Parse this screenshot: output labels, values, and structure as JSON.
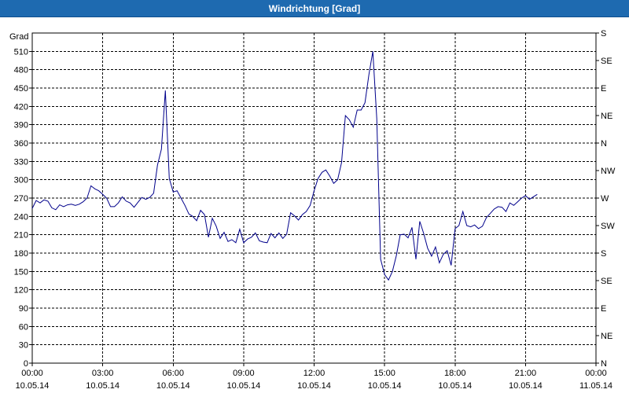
{
  "window": {
    "title": "Windrichtung [Grad]"
  },
  "colors": {
    "titlebar": "#1e6ab0",
    "line": "#00008b",
    "grid": "#000000"
  },
  "chart_data": {
    "type": "line",
    "title": "Windrichtung [Grad]",
    "ylabel": "Grad",
    "ylim": [
      0,
      540
    ],
    "yticks": [
      0,
      30,
      60,
      90,
      120,
      150,
      180,
      210,
      240,
      270,
      300,
      330,
      360,
      390,
      420,
      450,
      480,
      510
    ],
    "y2_labels": [
      "N",
      "NE",
      "E",
      "SE",
      "S",
      "SW",
      "W",
      "NW",
      "N",
      "NE",
      "E",
      "SE",
      "S"
    ],
    "xlim": [
      "10.05.14 00:00",
      "11.05.14 00:00"
    ],
    "x_ticks": [
      {
        "time": "00:00",
        "date": "10.05.14"
      },
      {
        "time": "03:00",
        "date": "10.05.14"
      },
      {
        "time": "06:00",
        "date": "10.05.14"
      },
      {
        "time": "09:00",
        "date": "10.05.14"
      },
      {
        "time": "12:00",
        "date": "10.05.14"
      },
      {
        "time": "15:00",
        "date": "10.05.14"
      },
      {
        "time": "18:00",
        "date": "10.05.14"
      },
      {
        "time": "21:00",
        "date": "10.05.14"
      },
      {
        "time": "00:00",
        "date": "11.05.14"
      }
    ],
    "grid": true,
    "series": [
      {
        "color": "#00008b",
        "points": [
          [
            "00:00",
            253
          ],
          [
            "00:10",
            266
          ],
          [
            "00:20",
            262
          ],
          [
            "00:30",
            267
          ],
          [
            "00:40",
            265
          ],
          [
            "00:50",
            254
          ],
          [
            "01:00",
            251
          ],
          [
            "01:10",
            259
          ],
          [
            "01:20",
            256
          ],
          [
            "01:30",
            259
          ],
          [
            "01:40",
            260
          ],
          [
            "01:50",
            258
          ],
          [
            "02:00",
            260
          ],
          [
            "02:10",
            264
          ],
          [
            "02:20",
            270
          ],
          [
            "02:30",
            290
          ],
          [
            "02:40",
            285
          ],
          [
            "02:50",
            282
          ],
          [
            "03:00",
            276
          ],
          [
            "03:10",
            270
          ],
          [
            "03:20",
            256
          ],
          [
            "03:30",
            256
          ],
          [
            "03:40",
            262
          ],
          [
            "03:50",
            272
          ],
          [
            "04:00",
            265
          ],
          [
            "04:10",
            262
          ],
          [
            "04:20",
            255
          ],
          [
            "04:30",
            263
          ],
          [
            "04:40",
            271
          ],
          [
            "04:50",
            268
          ],
          [
            "05:00",
            271
          ],
          [
            "05:10",
            278
          ],
          [
            "05:20",
            324
          ],
          [
            "05:30",
            350
          ],
          [
            "05:40",
            446
          ],
          [
            "05:50",
            302
          ],
          [
            "06:00",
            280
          ],
          [
            "06:10",
            282
          ],
          [
            "06:20",
            270
          ],
          [
            "06:30",
            258
          ],
          [
            "06:40",
            244
          ],
          [
            "06:50",
            240
          ],
          [
            "07:00",
            233
          ],
          [
            "07:10",
            250
          ],
          [
            "07:20",
            243
          ],
          [
            "07:30",
            206
          ],
          [
            "07:40",
            237
          ],
          [
            "07:50",
            224
          ],
          [
            "08:00",
            204
          ],
          [
            "08:10",
            214
          ],
          [
            "08:20",
            199
          ],
          [
            "08:30",
            202
          ],
          [
            "08:40",
            197
          ],
          [
            "08:50",
            219
          ],
          [
            "09:00",
            197
          ],
          [
            "09:10",
            203
          ],
          [
            "09:20",
            206
          ],
          [
            "09:30",
            213
          ],
          [
            "09:40",
            200
          ],
          [
            "09:50",
            198
          ],
          [
            "10:00",
            197
          ],
          [
            "10:10",
            212
          ],
          [
            "10:20",
            205
          ],
          [
            "10:30",
            213
          ],
          [
            "10:40",
            204
          ],
          [
            "10:50",
            211
          ],
          [
            "11:00",
            246
          ],
          [
            "11:10",
            241
          ],
          [
            "11:20",
            234
          ],
          [
            "11:30",
            243
          ],
          [
            "11:40",
            248
          ],
          [
            "11:50",
            258
          ],
          [
            "12:00",
            282
          ],
          [
            "12:10",
            302
          ],
          [
            "12:20",
            312
          ],
          [
            "12:30",
            316
          ],
          [
            "12:40",
            306
          ],
          [
            "12:50",
            294
          ],
          [
            "13:00",
            300
          ],
          [
            "13:10",
            328
          ],
          [
            "13:20",
            405
          ],
          [
            "13:30",
            398
          ],
          [
            "13:40",
            386
          ],
          [
            "13:50",
            414
          ],
          [
            "14:00",
            414
          ],
          [
            "14:10",
            426
          ],
          [
            "14:20",
            472
          ],
          [
            "14:30",
            510
          ],
          [
            "14:40",
            400
          ],
          [
            "14:50",
            170
          ],
          [
            "15:00",
            145
          ],
          [
            "15:10",
            136
          ],
          [
            "15:20",
            150
          ],
          [
            "15:30",
            176
          ],
          [
            "15:40",
            210
          ],
          [
            "15:50",
            211
          ],
          [
            "16:00",
            205
          ],
          [
            "16:10",
            222
          ],
          [
            "16:20",
            170
          ],
          [
            "16:30",
            232
          ],
          [
            "16:40",
            212
          ],
          [
            "16:50",
            188
          ],
          [
            "17:00",
            175
          ],
          [
            "17:10",
            190
          ],
          [
            "17:20",
            164
          ],
          [
            "17:30",
            178
          ],
          [
            "17:40",
            184
          ],
          [
            "17:50",
            160
          ],
          [
            "18:00",
            220
          ],
          [
            "18:10",
            225
          ],
          [
            "18:20",
            248
          ],
          [
            "18:30",
            225
          ],
          [
            "18:40",
            223
          ],
          [
            "18:50",
            226
          ],
          [
            "19:00",
            220
          ],
          [
            "19:10",
            224
          ],
          [
            "19:20",
            238
          ],
          [
            "19:30",
            245
          ],
          [
            "19:40",
            252
          ],
          [
            "19:50",
            256
          ],
          [
            "20:00",
            255
          ],
          [
            "20:10",
            248
          ],
          [
            "20:20",
            262
          ],
          [
            "20:30",
            258
          ],
          [
            "20:40",
            264
          ],
          [
            "20:50",
            270
          ],
          [
            "21:00",
            274
          ],
          [
            "21:10",
            268
          ],
          [
            "21:20",
            272
          ],
          [
            "21:30",
            276
          ]
        ]
      }
    ]
  }
}
